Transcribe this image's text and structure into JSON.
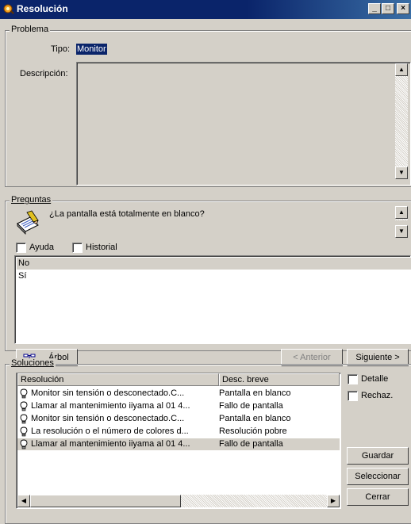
{
  "window": {
    "title": "Resolución",
    "min_label": "_",
    "max_label": "□",
    "close_label": "×"
  },
  "problema": {
    "legend": "Problema",
    "tipo_label": "Tipo:",
    "tipo_value": "Monitor",
    "descripcion_label": "Descripción:"
  },
  "preguntas": {
    "legend": "Preguntas",
    "question": "¿La pantalla está totalmente en blanco?",
    "ayuda_label": "Ayuda",
    "historial_label": "Historial",
    "answers": [
      "No",
      "Sí"
    ],
    "arbol_label": "Árbol",
    "anterior_label": "< Anterior",
    "siguiente_label": "Siguiente >"
  },
  "soluciones": {
    "legend": "Soluciones",
    "columns": [
      "Resolución",
      "Desc. breve"
    ],
    "rows": [
      {
        "resolucion": "Monitor sin tensión o desconectado.C...",
        "desc": "Pantalla en blanco"
      },
      {
        "resolucion": "Llamar al mantenimiento iiyama al 01 4...",
        "desc": "Fallo de pantalla"
      },
      {
        "resolucion": "Monitor sin tensión o desconectado.C...",
        "desc": "Pantalla en blanco"
      },
      {
        "resolucion": "La resolución o el número de colores d...",
        "desc": "Resolución pobre"
      },
      {
        "resolucion": "Llamar al mantenimiento iiyama al 01 4...",
        "desc": "Fallo de pantalla"
      }
    ],
    "selected_row": 4,
    "detalle_label": "Detalle",
    "rechaz_label": "Rechaz.",
    "guardar_label": "Guardar",
    "seleccionar_label": "Seleccionar",
    "cerrar_label": "Cerrar"
  },
  "colors": {
    "title_bar": "#0a246a",
    "selection": "#0a246a",
    "list_selected_row": "#d4d0c8",
    "window_bg": "#d4d0c8"
  }
}
